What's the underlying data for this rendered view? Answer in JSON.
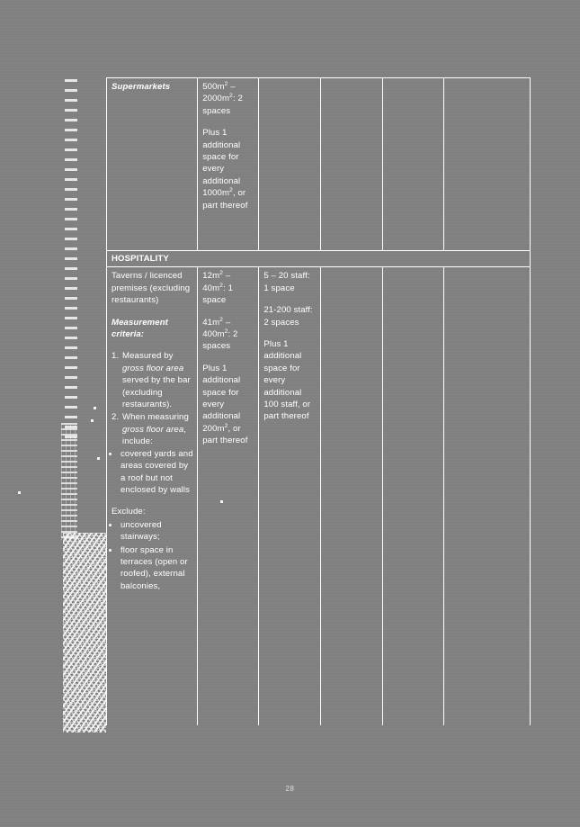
{
  "page": {
    "background_color": "#808080",
    "text_color": "#ffffff",
    "folio": "28"
  },
  "table": {
    "columns": 6,
    "rows": [
      {
        "type": "data",
        "name": "supermarkets-row",
        "cells": {
          "use": {
            "title": "Supermarkets",
            "title_style": "bold-italic"
          },
          "gfa_requirement": {
            "rate_1": "500m² – 2000m²: 2 spaces",
            "rate_2": "Plus 1 additional space for every additional 1000m², or part thereof"
          },
          "staff_requirement": "",
          "col4": "",
          "col5": "",
          "col6": ""
        }
      },
      {
        "type": "category",
        "name": "hospitality-category-row",
        "label": "HOSPITALITY"
      },
      {
        "type": "data",
        "name": "taverns-row",
        "cells": {
          "use": {
            "title": "Taverns / licenced premises (excluding restaurants)",
            "criteria_heading": "Measurement criteria:",
            "numbered": [
              "Measured by gross floor area served by the bar (excluding restaurants).",
              "When measuring gross floor area, include:"
            ],
            "include_bullets": [
              "covered yards and areas covered by a roof but not enclosed by walls"
            ],
            "exclude_heading": "Exclude:",
            "exclude_bullets": [
              "uncovered stairways;",
              "floor space in terraces (open or roofed), external balconies,"
            ]
          },
          "gfa_requirement": {
            "rate_1": "12m² – 40m²: 1 space",
            "rate_2": "41m² – 400m²: 2 spaces",
            "rate_3": "Plus 1 additional space for every additional 200m², or part thereof"
          },
          "staff_requirement": {
            "rate_1": "5 – 20 staff: 1 space",
            "rate_2": "21-200 staff: 2 spaces",
            "rate_3": "Plus 1 additional space for every additional 100 staff, or part thereof"
          },
          "col4": "",
          "col5": "",
          "col6": ""
        }
      }
    ]
  }
}
